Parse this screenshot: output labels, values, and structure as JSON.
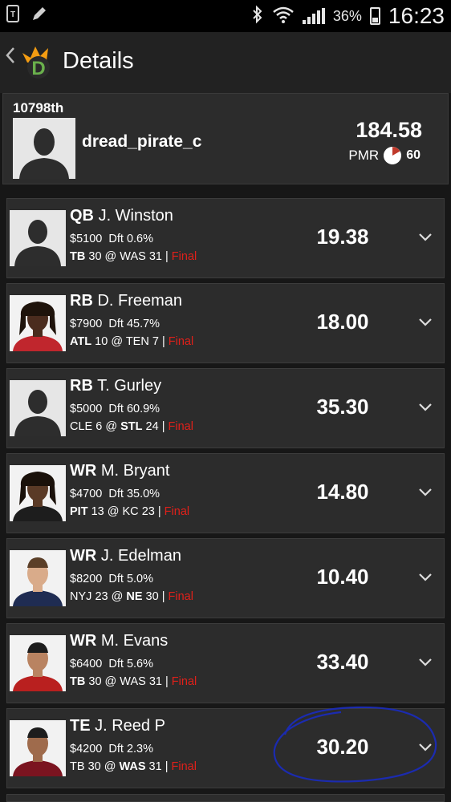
{
  "status_bar": {
    "battery": "36%",
    "time": "16:23"
  },
  "header": {
    "title": "Details"
  },
  "user": {
    "rank": "10798th",
    "username": "dread_pirate_c",
    "score": "184.58",
    "pmr_label": "PMR",
    "pmr_value": "60"
  },
  "players": [
    {
      "pos": "QB",
      "name": "J. Winston",
      "salary": "$5100",
      "dft": "Dft 0.6%",
      "team1": "TB",
      "score1": "30",
      "team2": "WAS",
      "score2": "31",
      "bold": 1,
      "status": "Final",
      "points": "19.38",
      "photo": "silhouette"
    },
    {
      "pos": "RB",
      "name": "D. Freeman",
      "salary": "$7900",
      "dft": "Dft 45.7%",
      "team1": "ATL",
      "score1": "10",
      "team2": "TEN",
      "score2": "7",
      "bold": 1,
      "status": "Final",
      "points": "18.00",
      "photo": "dreads-red"
    },
    {
      "pos": "RB",
      "name": "T. Gurley",
      "salary": "$5000",
      "dft": "Dft 60.9%",
      "team1": "CLE",
      "score1": "6",
      "team2": "STL",
      "score2": "24",
      "bold": 2,
      "status": "Final",
      "points": "35.30",
      "photo": "silhouette"
    },
    {
      "pos": "WR",
      "name": "M. Bryant",
      "salary": "$4700",
      "dft": "Dft 35.0%",
      "team1": "PIT",
      "score1": "13",
      "team2": "KC",
      "score2": "23",
      "bold": 1,
      "status": "Final",
      "points": "14.80",
      "photo": "dreads-dark"
    },
    {
      "pos": "WR",
      "name": "J. Edelman",
      "salary": "$8200",
      "dft": "Dft 5.0%",
      "team1": "NYJ",
      "score1": "23",
      "team2": "NE",
      "score2": "30",
      "bold": 2,
      "status": "Final",
      "points": "10.40",
      "photo": "short-navy"
    },
    {
      "pos": "WR",
      "name": "M. Evans",
      "salary": "$6400",
      "dft": "Dft 5.6%",
      "team1": "TB",
      "score1": "30",
      "team2": "WAS",
      "score2": "31",
      "bold": 1,
      "status": "Final",
      "points": "33.40",
      "photo": "short-red"
    },
    {
      "pos": "TE",
      "name": "J. Reed",
      "injury": "P",
      "salary": "$4200",
      "dft": "Dft 2.3%",
      "team1": "TB",
      "score1": "30",
      "team2": "WAS",
      "score2": "31",
      "bold": 2,
      "status": "Final",
      "points": "30.20",
      "photo": "short-maroon",
      "circled": true
    }
  ],
  "colors": {
    "background": "#171717",
    "card": "#2c2c2c",
    "final_status": "#e0201a",
    "annotation": "#1b2bb0"
  }
}
